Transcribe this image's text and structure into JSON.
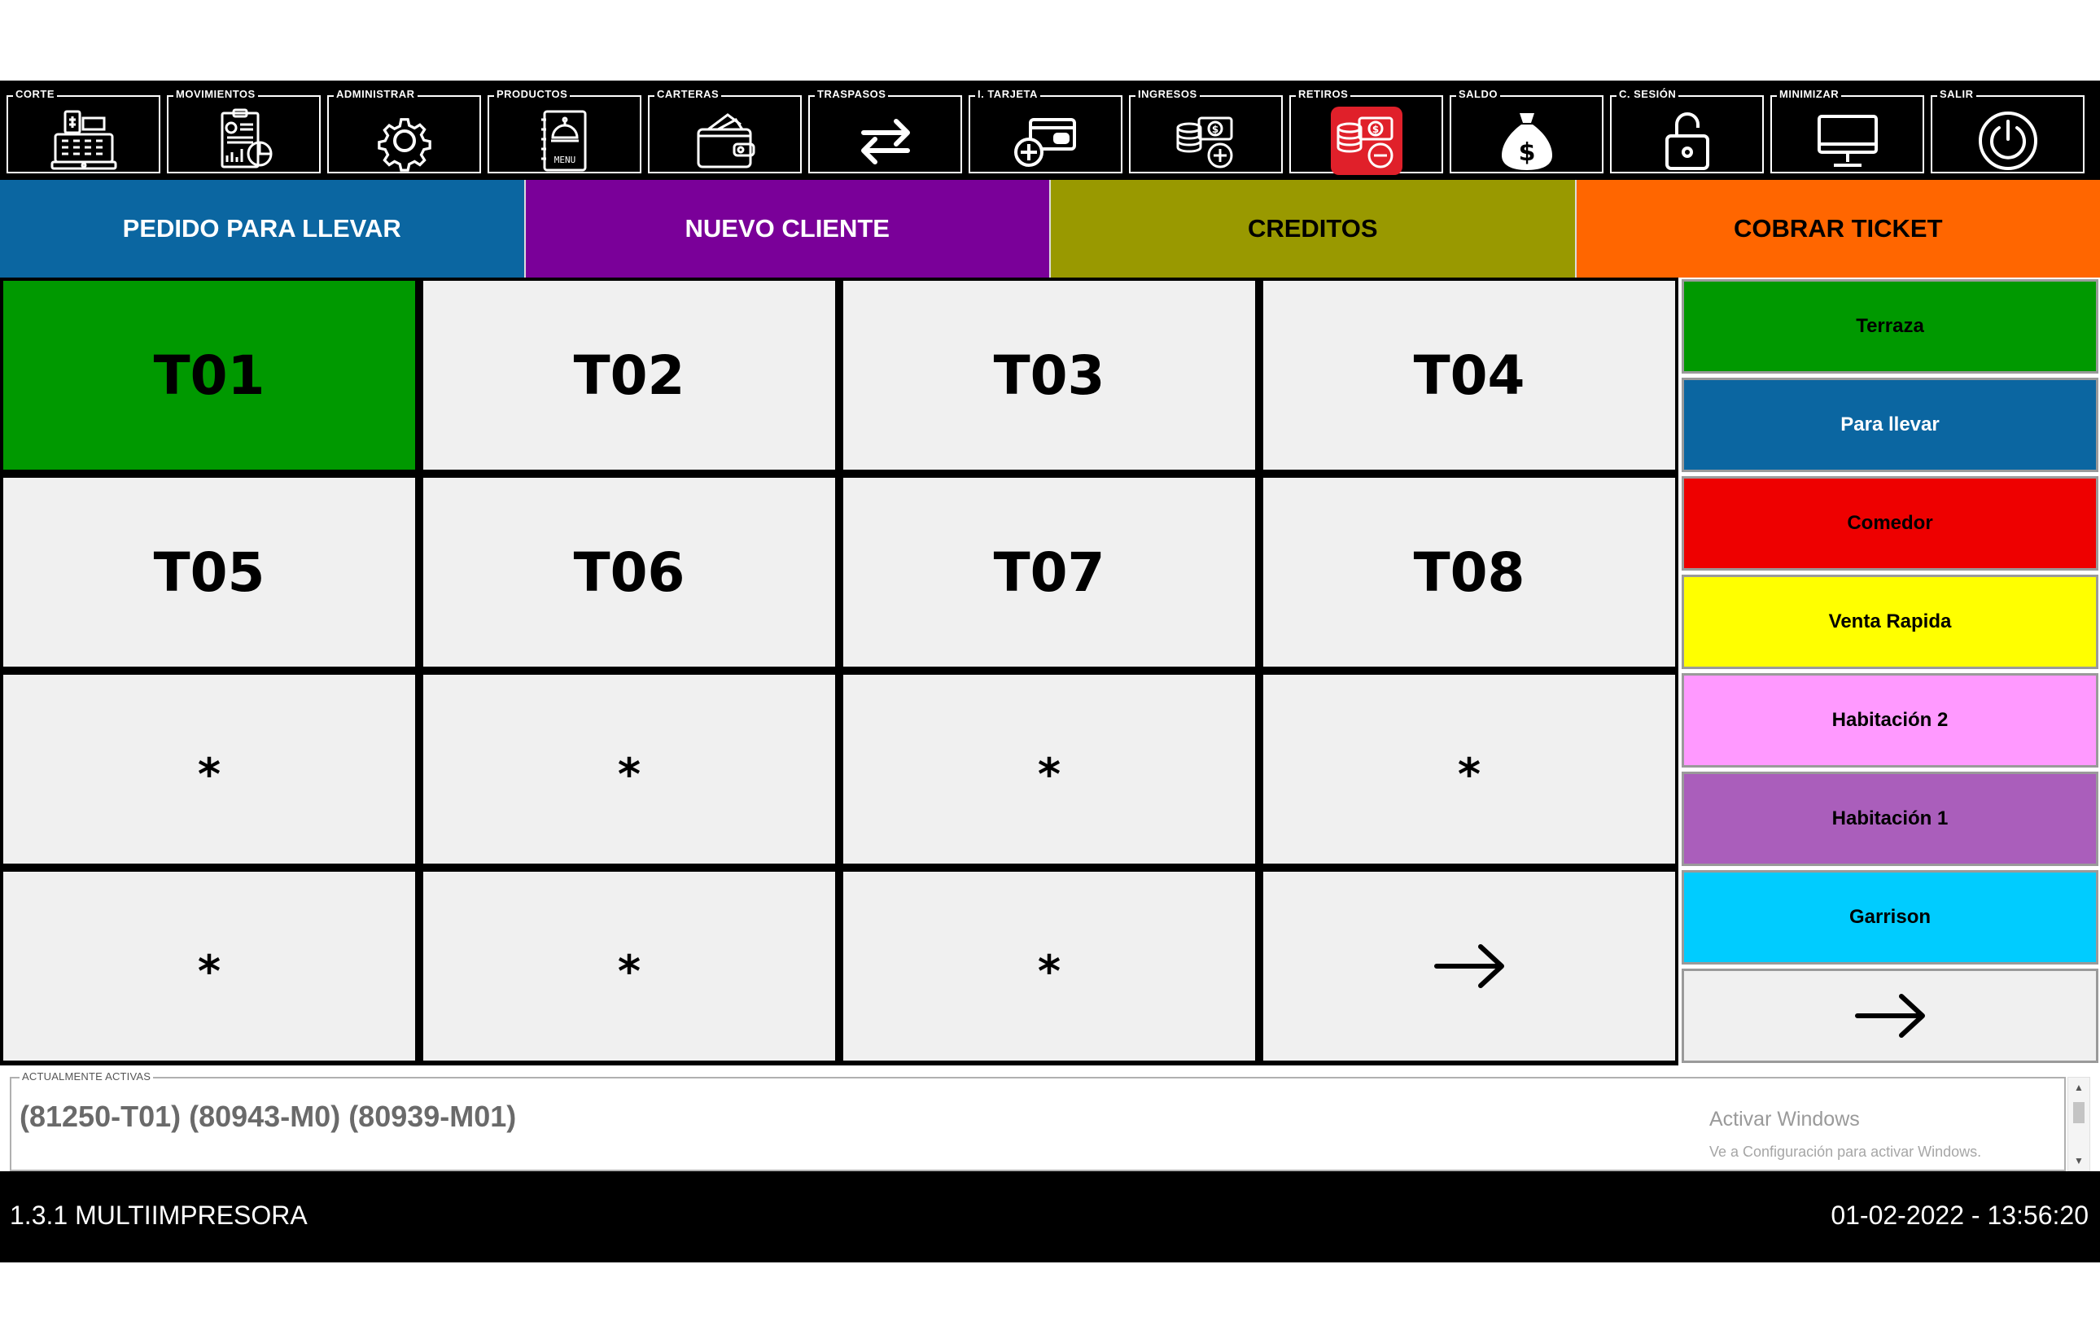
{
  "toolbar": {
    "items": [
      {
        "label": "CORTE",
        "icon": "cash-register-icon"
      },
      {
        "label": "MOVIMIENTOS",
        "icon": "report-chart-icon"
      },
      {
        "label": "ADMINISTRAR",
        "icon": "gear-icon"
      },
      {
        "label": "PRODUCTOS",
        "icon": "menu-book-icon",
        "icon_text": "MENU"
      },
      {
        "label": "CARTERAS",
        "icon": "wallet-icon"
      },
      {
        "label": "TRASPASOS",
        "icon": "transfer-arrows-icon"
      },
      {
        "label": "I. TARJETA",
        "icon": "card-plus-icon"
      },
      {
        "label": "INGRESOS",
        "icon": "coins-plus-icon"
      },
      {
        "label": "RETIROS",
        "icon": "coins-minus-icon"
      },
      {
        "label": "SALDO",
        "icon": "money-bag-icon",
        "icon_text": "$"
      },
      {
        "label": "C. SESIÓN",
        "icon": "unlock-icon"
      },
      {
        "label": "MINIMIZAR",
        "icon": "monitor-icon"
      },
      {
        "label": "SALIR",
        "icon": "power-icon"
      }
    ]
  },
  "actions": [
    {
      "label": "PEDIDO PARA LLEVAR",
      "bg": "#0b66a1",
      "fg": "#ffffff"
    },
    {
      "label": "NUEVO CLIENTE",
      "bg": "#7a0099",
      "fg": "#ffffff"
    },
    {
      "label": "CREDITOS",
      "bg": "#999900",
      "fg": "#000000"
    },
    {
      "label": "COBRAR TICKET",
      "bg": "#ff6600",
      "fg": "#000000"
    }
  ],
  "tables": {
    "cells": [
      "T01",
      "T02",
      "T03",
      "T04",
      "T05",
      "T06",
      "T07",
      "T08",
      "*",
      "*",
      "*",
      "*",
      "*",
      "*",
      "*"
    ],
    "occupied_color": "#009900",
    "free_color": "#f0f0f0"
  },
  "zones": [
    {
      "label": "Terraza",
      "bg": "#009900",
      "fg": "#000000"
    },
    {
      "label": "Para llevar",
      "bg": "#0b66a1",
      "fg": "#ffffff"
    },
    {
      "label": "Comedor",
      "bg": "#ee0000",
      "fg": "#000000"
    },
    {
      "label": "Venta Rapida",
      "bg": "#ffff00",
      "fg": "#000000"
    },
    {
      "label": "Habitación 2",
      "bg": "#ff99ff",
      "fg": "#000000"
    },
    {
      "label": "Habitación 1",
      "bg": "#aa5ebb",
      "fg": "#000000"
    },
    {
      "label": "Garrison",
      "bg": "#00ccff",
      "fg": "#000000"
    }
  ],
  "active": {
    "legend": "ACTUALMENTE ACTIVAS",
    "text": "(81250-T01) (80943-M0) (80939-M01)"
  },
  "watermark": {
    "title": "Activar Windows",
    "subtitle": "Ve a Configuración para activar Windows."
  },
  "status": {
    "version": "1.3.1 MULTIIMPRESORA",
    "datetime": "01-02-2022  -  13:56:20"
  }
}
